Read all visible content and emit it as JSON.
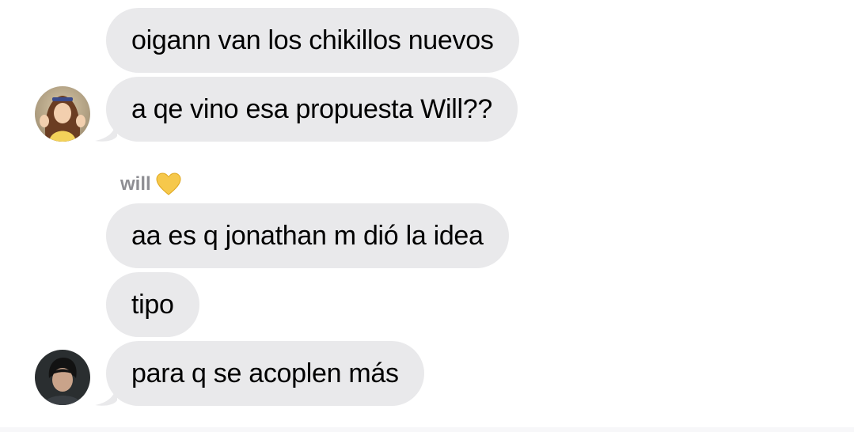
{
  "groups": [
    {
      "sender": "",
      "avatar": "girl-avatar",
      "messages": [
        "oigann van los chikillos nuevos",
        "a qe vino esa propuesta Will??"
      ]
    },
    {
      "sender": "will",
      "sender_emoji": "yellow-heart-icon",
      "avatar": "boy-avatar",
      "messages": [
        "aa es q jonathan m dió la idea",
        "tipo",
        "para q se acoplen más"
      ]
    }
  ],
  "colors": {
    "bubble": "#e9e9eb",
    "text": "#000000",
    "sender": "#8e8e93",
    "heart": "#f6c84b"
  }
}
